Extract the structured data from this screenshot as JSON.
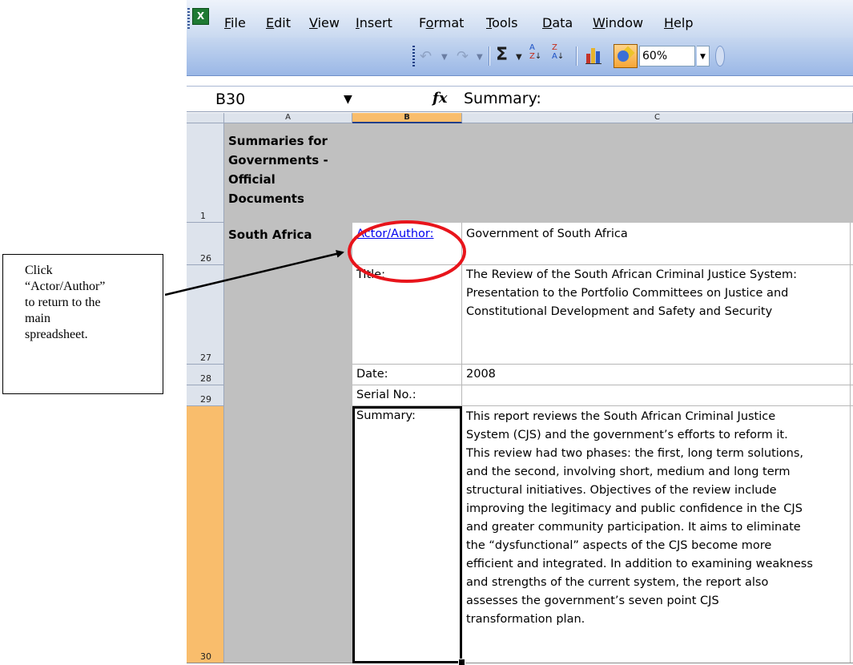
{
  "app": {
    "icon_label": "X"
  },
  "menu": [
    {
      "label": "File",
      "key": "F",
      "rest": "ile"
    },
    {
      "label": "Edit",
      "key": "E",
      "rest": "dit"
    },
    {
      "label": "View",
      "key": "V",
      "rest": "iew"
    },
    {
      "label": "Insert",
      "key": "I",
      "rest": "nsert"
    },
    {
      "label": "Format",
      "pre": "F",
      "key": "o",
      "rest": "rmat"
    },
    {
      "label": "Tools",
      "key": "T",
      "rest": "ools"
    },
    {
      "label": "Data",
      "key": "D",
      "rest": "ata"
    },
    {
      "label": "Window",
      "key": "W",
      "rest": "indow"
    },
    {
      "label": "Help",
      "key": "H",
      "rest": "elp"
    }
  ],
  "toolbar": {
    "undo_icon": "undo-icon",
    "redo_icon": "redo-icon",
    "autosum_icon": "sigma-icon",
    "sort_asc_icon": "sort-ascending-icon",
    "sort_desc_icon": "sort-descending-icon",
    "chart_icon": "chart-wizard-icon",
    "drawing_icon": "drawing-icon",
    "zoom": "60%"
  },
  "formula_bar": {
    "name_box": "B30",
    "fx_label": "fx",
    "formula": "Summary:"
  },
  "columns": [
    "A",
    "B",
    "C"
  ],
  "selected_column": "B",
  "rows": [
    "1",
    "26",
    "27",
    "28",
    "29",
    "30"
  ],
  "selected_row": "30",
  "cells": {
    "a1": [
      "Summaries for",
      "Governments -",
      "Official",
      "Documents"
    ],
    "a26": "South Africa",
    "b26": "Actor/Author:",
    "c26": "Government of South Africa",
    "b27": "Title:",
    "c27": [
      "The Review of the South African Criminal Justice System:",
      "Presentation to the Portfolio Committees on Justice and",
      "Constitutional Development and Safety and Security"
    ],
    "b28": "Date:",
    "c28": "2008",
    "b29": "Serial No.:",
    "b30": "Summary:",
    "c30": [
      "This report reviews the South African Criminal Justice",
      "System (CJS) and the government’s efforts to reform it.",
      "This review had two phases: the first,  long term solutions,",
      "and the second, involving short, medium and long term",
      "structural initiatives. Objectives of the review include",
      "improving the legitimacy and public confidence in the CJS",
      "and greater community participation. It aims to eliminate",
      "the “dysfunctional” aspects of the CJS become more",
      "efficient and integrated. In addition to examining weakness",
      "and strengths of the current system, the report also",
      "assesses the government’s seven point CJS",
      "transformation plan."
    ]
  },
  "callout": {
    "lines": [
      "Click",
      "“Actor/Author”",
      "to return to the",
      "main",
      "spreadsheet."
    ]
  },
  "colors": {
    "highlight_circle": "#e8141b",
    "link": "#0000ee",
    "selected_header": "#f9bd6c",
    "grey_fill": "#c0c0c0"
  }
}
